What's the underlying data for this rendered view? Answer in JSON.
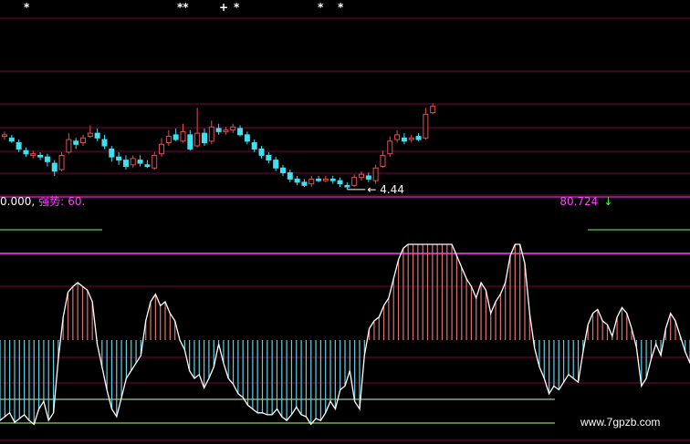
{
  "chart_data": [
    {
      "type": "candlestick",
      "panel": "price",
      "low_marker_label": "4.44",
      "markers": [
        "*",
        "**",
        "+",
        "*",
        "*",
        "*"
      ],
      "colors": {
        "up": "#e05050",
        "down": "#40e0f0",
        "marker": "#ffffff",
        "grid": "#800040"
      },
      "candles": [
        {
          "o": 7.8,
          "c": 7.9,
          "h": 8.1,
          "l": 7.6
        },
        {
          "o": 7.7,
          "c": 7.5,
          "h": 7.9,
          "l": 7.4
        },
        {
          "o": 7.4,
          "c": 7.0,
          "h": 7.6,
          "l": 6.8
        },
        {
          "o": 6.9,
          "c": 6.7,
          "h": 7.1,
          "l": 6.5
        },
        {
          "o": 6.6,
          "c": 6.7,
          "h": 6.9,
          "l": 6.4
        },
        {
          "o": 6.6,
          "c": 6.5,
          "h": 6.8,
          "l": 6.3
        },
        {
          "o": 6.5,
          "c": 6.2,
          "h": 6.7,
          "l": 5.9
        },
        {
          "o": 6.1,
          "c": 5.6,
          "h": 6.3,
          "l": 5.3
        },
        {
          "o": 5.7,
          "c": 6.6,
          "h": 6.8,
          "l": 5.6
        },
        {
          "o": 6.8,
          "c": 7.6,
          "h": 8.0,
          "l": 6.7
        },
        {
          "o": 7.5,
          "c": 7.3,
          "h": 7.7,
          "l": 7.0
        },
        {
          "o": 7.4,
          "c": 7.7,
          "h": 7.9,
          "l": 7.2
        },
        {
          "o": 7.8,
          "c": 8.0,
          "h": 8.5,
          "l": 7.7
        },
        {
          "o": 8.0,
          "c": 7.7,
          "h": 8.3,
          "l": 7.5
        },
        {
          "o": 7.6,
          "c": 7.2,
          "h": 7.9,
          "l": 7.0
        },
        {
          "o": 7.0,
          "c": 6.5,
          "h": 7.2,
          "l": 6.2
        },
        {
          "o": 6.5,
          "c": 6.3,
          "h": 6.8,
          "l": 6.0
        },
        {
          "o": 6.3,
          "c": 5.9,
          "h": 6.6,
          "l": 5.7
        },
        {
          "o": 6.0,
          "c": 6.4,
          "h": 6.6,
          "l": 5.8
        },
        {
          "o": 6.3,
          "c": 6.1,
          "h": 6.6,
          "l": 5.9
        },
        {
          "o": 6.0,
          "c": 5.9,
          "h": 6.3,
          "l": 5.8
        },
        {
          "o": 5.8,
          "c": 6.6,
          "h": 6.8,
          "l": 5.7
        },
        {
          "o": 6.7,
          "c": 7.3,
          "h": 7.7,
          "l": 6.5
        },
        {
          "o": 7.4,
          "c": 7.8,
          "h": 8.2,
          "l": 7.2
        },
        {
          "o": 7.9,
          "c": 7.6,
          "h": 8.3,
          "l": 7.5
        },
        {
          "o": 7.5,
          "c": 8.1,
          "h": 8.6,
          "l": 7.4
        },
        {
          "o": 7.9,
          "c": 7.0,
          "h": 8.2,
          "l": 6.9
        },
        {
          "o": 7.2,
          "c": 8.0,
          "h": 9.6,
          "l": 7.1
        },
        {
          "o": 8.0,
          "c": 7.4,
          "h": 8.3,
          "l": 7.2
        },
        {
          "o": 7.5,
          "c": 8.4,
          "h": 8.8,
          "l": 7.3
        },
        {
          "o": 8.3,
          "c": 8.1,
          "h": 8.6,
          "l": 7.9
        },
        {
          "o": 8.1,
          "c": 8.2,
          "h": 8.4,
          "l": 7.9
        },
        {
          "o": 8.2,
          "c": 8.4,
          "h": 8.6,
          "l": 8.0
        },
        {
          "o": 8.3,
          "c": 7.9,
          "h": 8.5,
          "l": 7.8
        },
        {
          "o": 7.9,
          "c": 7.5,
          "h": 8.1,
          "l": 7.3
        },
        {
          "o": 7.4,
          "c": 7.0,
          "h": 7.6,
          "l": 6.8
        },
        {
          "o": 7.0,
          "c": 6.6,
          "h": 7.2,
          "l": 6.4
        },
        {
          "o": 6.6,
          "c": 6.3,
          "h": 6.8,
          "l": 6.1
        },
        {
          "o": 6.3,
          "c": 5.8,
          "h": 6.5,
          "l": 5.6
        },
        {
          "o": 5.8,
          "c": 5.5,
          "h": 6.0,
          "l": 5.3
        },
        {
          "o": 5.5,
          "c": 5.1,
          "h": 5.7,
          "l": 4.9
        },
        {
          "o": 5.1,
          "c": 4.9,
          "h": 5.3,
          "l": 4.7
        },
        {
          "o": 4.9,
          "c": 4.7,
          "h": 5.1,
          "l": 4.6
        },
        {
          "o": 4.8,
          "c": 5.1,
          "h": 5.3,
          "l": 4.6
        },
        {
          "o": 5.1,
          "c": 5.0,
          "h": 5.3,
          "l": 4.9
        },
        {
          "o": 5.0,
          "c": 5.1,
          "h": 5.3,
          "l": 4.9
        },
        {
          "o": 5.1,
          "c": 5.0,
          "h": 5.3,
          "l": 4.8
        },
        {
          "o": 5.0,
          "c": 4.8,
          "h": 5.2,
          "l": 4.6
        },
        {
          "o": 4.7,
          "c": 4.6,
          "h": 4.9,
          "l": 4.44
        },
        {
          "o": 4.7,
          "c": 5.2,
          "h": 5.4,
          "l": 4.6
        },
        {
          "o": 5.2,
          "c": 5.4,
          "h": 5.6,
          "l": 5.0
        },
        {
          "o": 5.3,
          "c": 5.1,
          "h": 5.5,
          "l": 4.9
        },
        {
          "o": 5.0,
          "c": 5.8,
          "h": 6.0,
          "l": 4.8
        },
        {
          "o": 5.9,
          "c": 6.6,
          "h": 6.9,
          "l": 5.8
        },
        {
          "o": 6.7,
          "c": 7.5,
          "h": 7.8,
          "l": 6.5
        },
        {
          "o": 7.6,
          "c": 7.9,
          "h": 8.2,
          "l": 7.4
        },
        {
          "o": 7.7,
          "c": 7.5,
          "h": 8.0,
          "l": 7.3
        },
        {
          "o": 7.6,
          "c": 7.7,
          "h": 7.9,
          "l": 7.4
        },
        {
          "o": 7.8,
          "c": 7.6,
          "h": 8.0,
          "l": 7.5
        },
        {
          "o": 7.7,
          "c": 9.2,
          "h": 9.6,
          "l": 7.6
        },
        {
          "o": 9.3,
          "c": 9.7,
          "h": 9.9,
          "l": 9.2
        }
      ]
    },
    {
      "type": "bar",
      "panel": "indicator",
      "legend": [
        {
          "text": "0.000,",
          "color": "#ffffff"
        },
        {
          "text": "强势:",
          "color": "#ff40ff"
        },
        {
          "text": "60.",
          "color": "#ff40ff"
        },
        {
          "text": "80.724",
          "color": "#ff40ff"
        },
        {
          "text": "↓",
          "color": "#40ff40"
        }
      ],
      "baseline": 50,
      "ylim": [
        0,
        100
      ],
      "levels": [
        80,
        20,
        10,
        0
      ],
      "colors": {
        "pos": "#e07070",
        "neg": "#60d0e0",
        "curve": "#ffffff",
        "level_high": "#ff40ff",
        "level_low": "#c0ffc0"
      },
      "values": [
        8,
        10,
        12,
        7,
        9,
        11,
        8,
        6,
        14,
        18,
        8,
        12,
        40,
        62,
        75,
        78,
        80,
        78,
        76,
        70,
        48,
        36,
        24,
        14,
        10,
        20,
        30,
        34,
        38,
        42,
        60,
        70,
        74,
        68,
        70,
        64,
        60,
        50,
        45,
        34,
        30,
        32,
        25,
        30,
        36,
        48,
        38,
        30,
        27,
        22,
        20,
        16,
        14,
        12,
        12,
        11,
        11,
        14,
        10,
        8,
        11,
        15,
        11,
        10,
        6,
        9,
        8,
        12,
        18,
        14,
        24,
        26,
        34,
        18,
        14,
        42,
        56,
        60,
        62,
        68,
        72,
        82,
        92,
        98,
        100,
        100,
        100,
        100,
        100,
        100,
        100,
        100,
        100,
        100,
        94,
        88,
        82,
        78,
        72,
        80,
        76,
        64,
        70,
        74,
        80,
        94,
        100,
        100,
        90,
        64,
        46,
        36,
        30,
        22,
        26,
        24,
        28,
        32,
        30,
        28,
        44,
        58,
        64,
        66,
        60,
        58,
        52,
        62,
        67,
        64,
        56,
        46,
        26,
        30,
        40,
        48,
        42,
        56,
        64,
        60,
        52,
        44,
        38
      ]
    }
  ],
  "watermark": "www.7gpzb.com"
}
